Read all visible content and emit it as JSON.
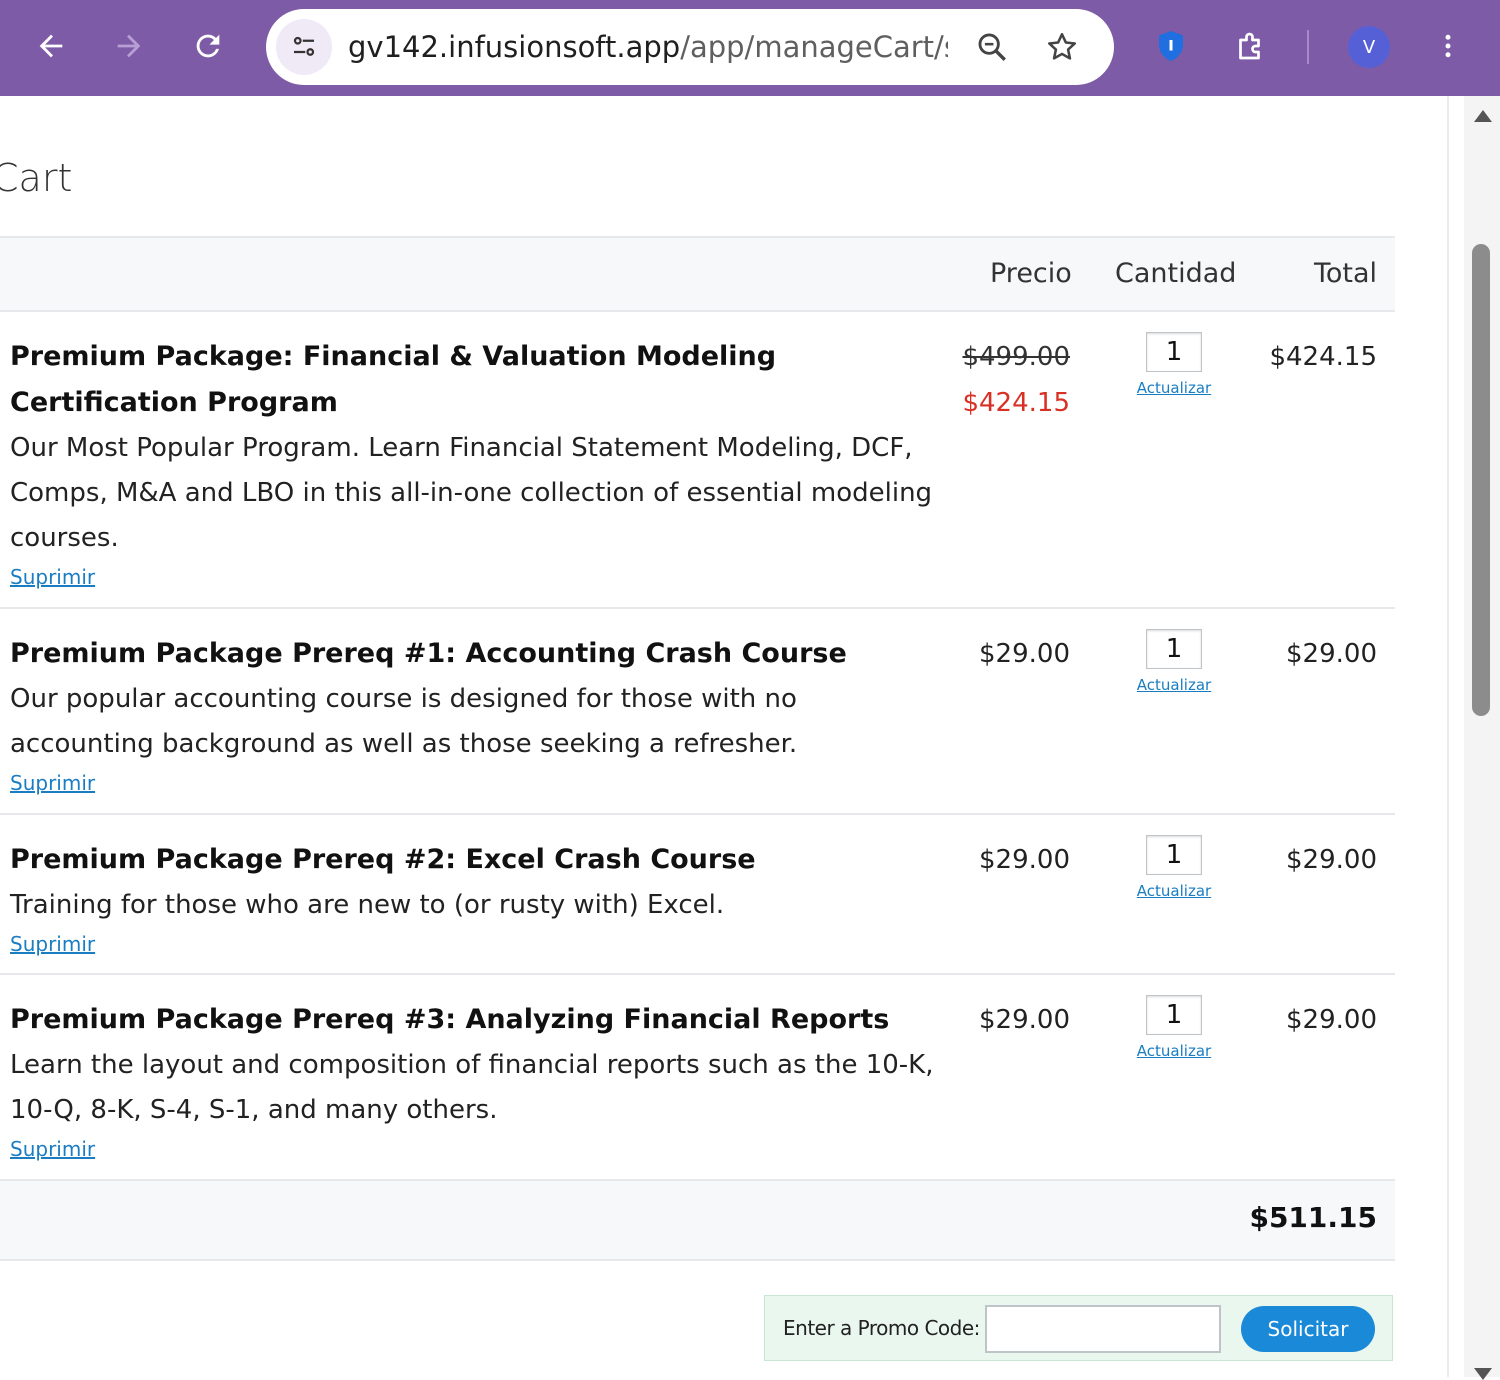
{
  "browser": {
    "url_host": "gv142.infusionsoft.app",
    "url_path": "/app/manageCart/s...",
    "profile_initial": "V",
    "toolbar_color": "#7d5ba6"
  },
  "page": {
    "title": "Cart"
  },
  "table": {
    "headers": {
      "price": "Precio",
      "quantity": "Cantidad",
      "total": "Total"
    },
    "remove_label": "Suprimir",
    "update_label": "Actualizar",
    "items": [
      {
        "name": "Premium Package: Financial & Valuation Modeling Certification Program",
        "description": "Our Most Popular Program. Learn Financial Statement Modeling, DCF, Comps, M&A and LBO in this all-in-one collection of essential modeling courses.",
        "original_price": "$499.00",
        "price": "$424.15",
        "quantity": "1",
        "total": "$424.15"
      },
      {
        "name": "Premium Package Prereq #1: Accounting Crash Course",
        "description": "Our popular accounting course is designed for those with no accounting background as well as those seeking a refresher.",
        "price": "$29.00",
        "quantity": "1",
        "total": "$29.00"
      },
      {
        "name": "Premium Package Prereq #2: Excel Crash Course",
        "description": "Training for those who are new to (or rusty with) Excel.",
        "price": "$29.00",
        "quantity": "1",
        "total": "$29.00"
      },
      {
        "name": "Premium Package Prereq #3: Analyzing Financial Reports",
        "description": "Learn the layout and composition of financial reports such as the 10-K, 10-Q, 8-K, S-4, S-1, and many others.",
        "price": "$29.00",
        "quantity": "1",
        "total": "$29.00"
      }
    ],
    "grand_total": "$511.15"
  },
  "promo": {
    "label": "Enter a Promo Code:",
    "value": "",
    "button_label": "Solicitar"
  },
  "colors": {
    "sale_price": "#d93025",
    "link": "#1a7dc2",
    "button": "#1a8ad8",
    "promo_bg": "#eaf7ef"
  }
}
